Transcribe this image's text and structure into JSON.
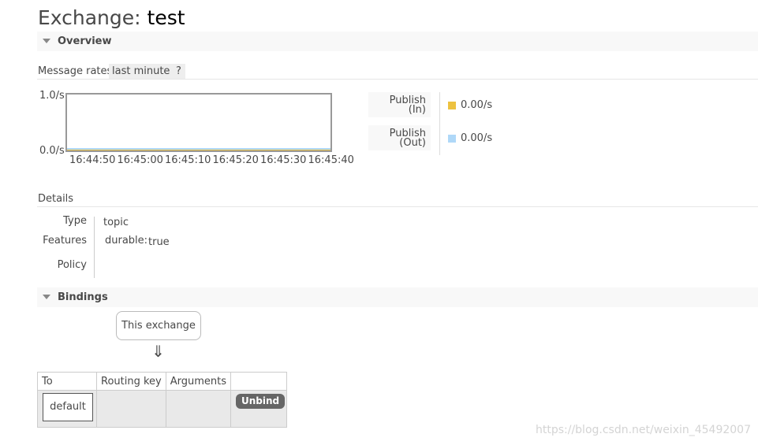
{
  "page": {
    "title_prefix": "Exchange:",
    "title_name": "test"
  },
  "overview": {
    "section_label": "Overview"
  },
  "message_rates": {
    "label": "Message rates",
    "range": "last minute",
    "help": "?",
    "chart_data": {
      "type": "area",
      "x": [
        "16:44:50",
        "16:45:00",
        "16:45:10",
        "16:45:20",
        "16:45:30",
        "16:45:40"
      ],
      "ylim": [
        0,
        1
      ],
      "y_ticks": [
        "1.0/s",
        "0.0/s"
      ],
      "series": [
        {
          "name": "Publish (In)",
          "values": [
            0,
            0,
            0,
            0,
            0,
            0
          ],
          "color": "#edc240"
        },
        {
          "name": "Publish (Out)",
          "values": [
            0,
            0,
            0,
            0,
            0,
            0
          ],
          "color": "#afd8f8"
        }
      ]
    },
    "legend": [
      {
        "line1": "Publish",
        "line2": "(In)",
        "value": "0.00/s",
        "color": "#edc240"
      },
      {
        "line1": "Publish",
        "line2": "(Out)",
        "value": "0.00/s",
        "color": "#afd8f8"
      }
    ]
  },
  "details": {
    "heading": "Details",
    "type_key": "Type",
    "type_value": "topic",
    "features_key": "Features",
    "durable_key": "durable:",
    "durable_value": "true",
    "policy_key": "Policy"
  },
  "bindings": {
    "section_label": "Bindings",
    "source_label": "This exchange",
    "arrow": "⇓",
    "columns": [
      "To",
      "Routing key",
      "Arguments",
      ""
    ],
    "rows": [
      {
        "to": "default",
        "routing_key": "",
        "arguments": "",
        "action": "Unbind"
      }
    ]
  },
  "watermark": "https://blog.csdn.net/weixin_45492007"
}
